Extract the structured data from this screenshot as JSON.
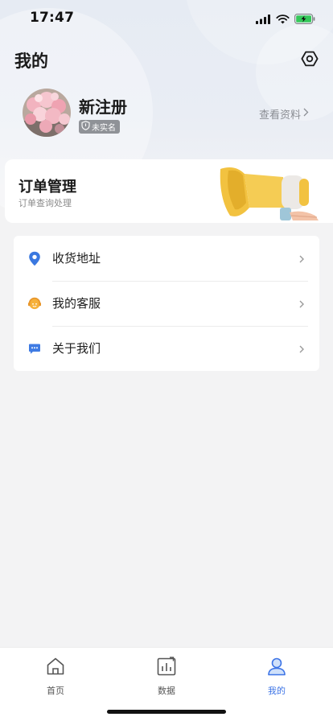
{
  "status_bar": {
    "time": "17:47",
    "icons": [
      "signal-icon",
      "wifi-icon",
      "battery-charging-icon"
    ]
  },
  "header": {
    "title": "我的",
    "settings_icon": "settings-hexagon-icon"
  },
  "profile": {
    "name": "新注册",
    "verify_badge": "未实名",
    "view_profile": "查看资料",
    "avatar": "flower-bouquet-avatar"
  },
  "order_card": {
    "title": "订单管理",
    "subtitle": "订单查询处理",
    "illustration": "megaphone-illustration"
  },
  "menu": {
    "items": [
      {
        "label": "收货地址",
        "icon": "location-pin-icon"
      },
      {
        "label": "我的客服",
        "icon": "customer-service-icon"
      },
      {
        "label": "关于我们",
        "icon": "chat-bubble-icon"
      }
    ]
  },
  "tabbar": {
    "tabs": [
      {
        "label": "首页",
        "icon": "home-icon",
        "active": false
      },
      {
        "label": "数据",
        "icon": "data-chart-icon",
        "active": false
      },
      {
        "label": "我的",
        "icon": "user-icon",
        "active": true
      }
    ]
  },
  "colors": {
    "accent": "#3d74e6",
    "page_bg": "#f3f3f4",
    "badge_bg": "#8f9297",
    "megaphone_yellow": "#f2c240"
  }
}
